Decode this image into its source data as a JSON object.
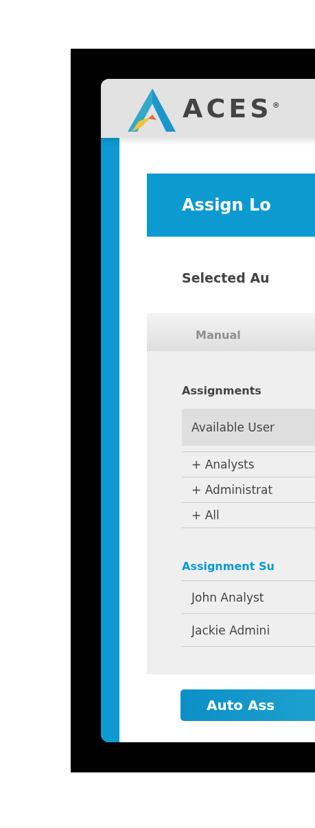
{
  "header": {
    "brand": "ACES$^{®}$"
  },
  "banner": {
    "title": "Assign Lo"
  },
  "selected_label": "Selected Au",
  "tabs": [
    {
      "label": "Manual",
      "selected": false
    }
  ],
  "assignments": {
    "title": "Assignments",
    "header": "Available User",
    "rows": [
      "+ Analysts",
      "+ Administrat",
      "+ All"
    ]
  },
  "summary": {
    "title": "Assignment Su",
    "rows": [
      "John Analyst",
      "Jackie Admini"
    ]
  },
  "button": "Auto Ass"
}
